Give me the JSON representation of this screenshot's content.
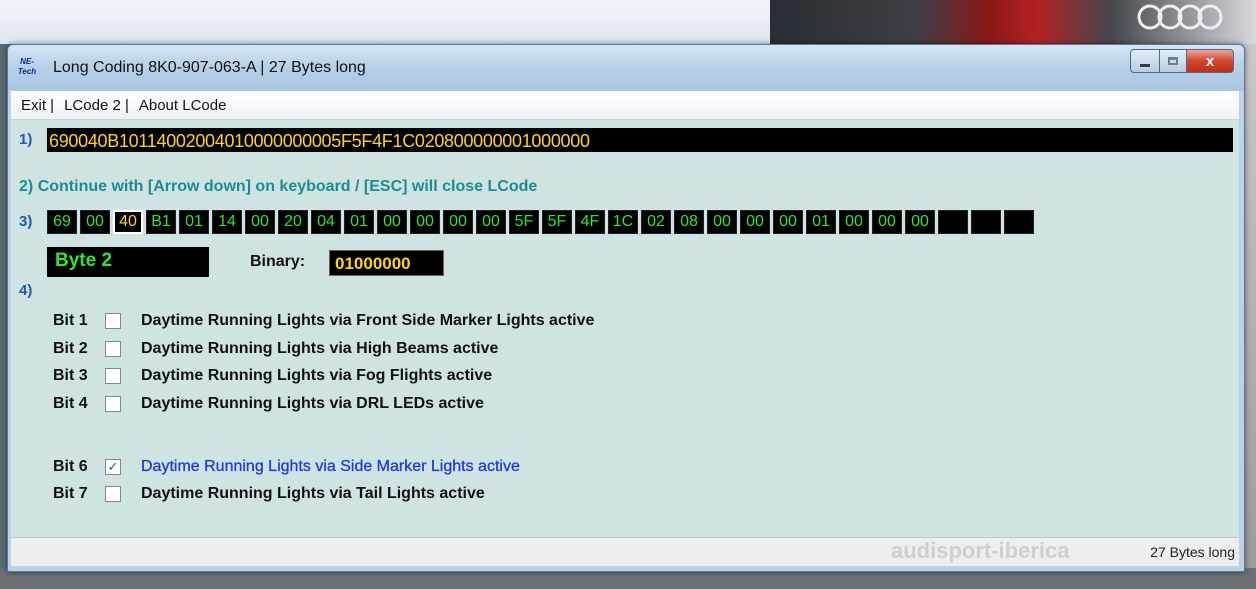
{
  "window": {
    "title": "Long Coding  8K0-907-063-A | 27 Bytes long",
    "app_icon_text": "NE-Tech",
    "close_glyph": "x"
  },
  "menu": [
    "Exit |",
    "LCode 2 |",
    "About LCode"
  ],
  "section1": {
    "label": "1)",
    "coding": "690040B10114002004010000000005F5F4F1C020800000001000000"
  },
  "section2": {
    "label": "2)",
    "text": "Continue with [Arrow down] on keyboard / [ESC] will close LCode"
  },
  "section3": {
    "label": "3)",
    "bytes": [
      "69",
      "00",
      "40",
      "B1",
      "01",
      "14",
      "00",
      "20",
      "04",
      "01",
      "00",
      "00",
      "00",
      "00",
      "5F",
      "5F",
      "4F",
      "1C",
      "02",
      "08",
      "00",
      "00",
      "00",
      "01",
      "00",
      "00",
      "00",
      "",
      "",
      ""
    ],
    "selected_index": 2,
    "byte_display": "Byte 2",
    "binary_label": "Binary:",
    "binary_value": "01000000"
  },
  "section4": {
    "label": "4)",
    "bits": [
      {
        "bit": "Bit 1",
        "checked": false,
        "desc": "Daytime Running Lights via Front Side Marker Lights active"
      },
      {
        "bit": "Bit 2",
        "checked": false,
        "desc": "Daytime Running Lights via High Beams active"
      },
      {
        "bit": "Bit 3",
        "checked": false,
        "desc": "Daytime Running Lights via Fog Flights active"
      },
      {
        "bit": "Bit 4",
        "checked": false,
        "desc": "Daytime Running Lights via DRL LEDs active"
      },
      {
        "bit": "Bit 6",
        "checked": true,
        "desc": "Daytime Running Lights via Side Marker Lights active"
      },
      {
        "bit": "Bit 7",
        "checked": false,
        "desc": "Daytime Running Lights via Tail Lights active"
      }
    ]
  },
  "status": {
    "text": "27 Bytes long",
    "watermark": "audisport-iberica"
  },
  "colors": {
    "accent": "#1f56c8",
    "hex_text": "#ffd21a",
    "byte_text": "#2fe62f",
    "instruction": "#1a8f8f",
    "checked_desc": "#1f3ae0"
  }
}
